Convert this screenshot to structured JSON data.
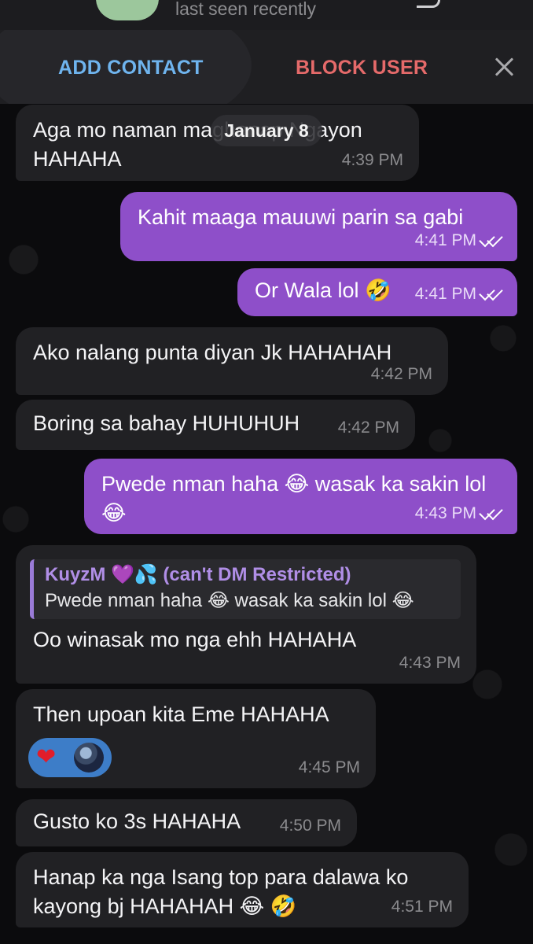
{
  "header": {
    "last_seen": "last seen recently"
  },
  "action_bar": {
    "add_contact": "ADD CONTACT",
    "block_user": "BLOCK USER"
  },
  "date_chip": "January 8",
  "messages": [
    {
      "dir": "in",
      "text": "Aga mo naman maghanap Ngayon HAHAHA",
      "time": "4:39 PM"
    },
    {
      "dir": "out",
      "text": "Kahit maaga mauuwi parin sa gabi",
      "time": "4:41 PM"
    },
    {
      "dir": "out",
      "text": "Or Wala lol 🤣",
      "time": "4:41 PM"
    },
    {
      "dir": "in",
      "text": "Ako nalang punta diyan Jk HAHAHAH",
      "time": "4:42 PM"
    },
    {
      "dir": "in",
      "text": "Boring sa bahay HUHUHUH",
      "time": "4:42 PM"
    },
    {
      "dir": "out",
      "text": "Pwede nman haha 😂 wasak ka sakin lol 😂",
      "time": "4:43 PM"
    },
    {
      "dir": "in",
      "reply_name": "KuyzM 💜💦 (can't DM Restricted)",
      "reply_text": "Pwede nman haha 😂 wasak ka sakin lol 😂",
      "text": "Oo winasak mo nga ehh HAHAHA",
      "time": "4:43 PM"
    },
    {
      "dir": "in",
      "text": "Then upoan kita Eme HAHAHA",
      "time": "4:45 PM",
      "reaction": "❤"
    },
    {
      "dir": "in",
      "text": "Gusto ko 3s HAHAHA",
      "time": "4:50 PM"
    },
    {
      "dir": "in",
      "text": "Hanap ka nga Isang top para dalawa ko kayong bj HAHAHAH 😂 🤣",
      "time": "4:51 PM"
    }
  ],
  "colors": {
    "outgoing_bubble": "#8e4fc9",
    "incoming_bubble": "#212124",
    "add_contact": "#6fb4ee",
    "block_user": "#e56a6a"
  }
}
